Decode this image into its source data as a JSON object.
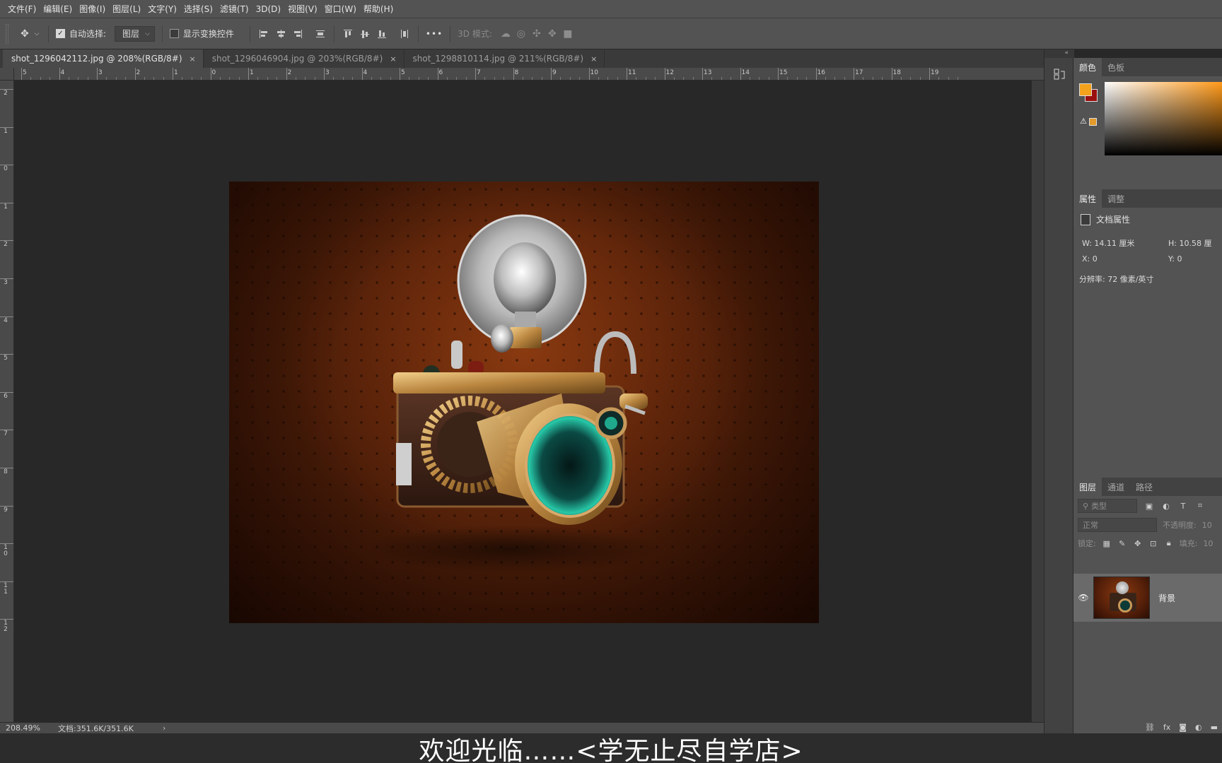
{
  "menu": [
    "文件(F)",
    "编辑(E)",
    "图像(I)",
    "图层(L)",
    "文字(Y)",
    "选择(S)",
    "滤镜(T)",
    "3D(D)",
    "视图(V)",
    "窗口(W)",
    "帮助(H)"
  ],
  "options": {
    "auto_select_label": "自动选择:",
    "auto_select_value": "图层",
    "transform_label": "显示变换控件",
    "more": "•••",
    "mode3d_label": "3D 模式:"
  },
  "tabs": [
    {
      "label": "shot_1296042112.jpg @ 208%(RGB/8#)",
      "close": "×"
    },
    {
      "label": "shot_1296046904.jpg @ 203%(RGB/8#)",
      "close": "×"
    },
    {
      "label": "shot_1298810114.jpg @ 211%(RGB/8#)",
      "close": "×"
    }
  ],
  "ruler_h": [
    "5",
    "4",
    "3",
    "2",
    "1",
    "0",
    "1",
    "2",
    "3",
    "4",
    "5",
    "6",
    "7",
    "8",
    "9",
    "10",
    "11",
    "12",
    "13",
    "14",
    "15",
    "16",
    "17",
    "18",
    "19"
  ],
  "ruler_v": [
    "2",
    "1",
    "0",
    "1",
    "2",
    "3",
    "4",
    "5",
    "6",
    "7",
    "8",
    "9",
    "10",
    "11",
    "12"
  ],
  "status": {
    "zoom": "208.49%",
    "doc": "文档:351.6K/351.6K",
    "arrow": "›"
  },
  "caption": "欢迎光临……<学无止尽自学店>",
  "color_panel": {
    "tabs": [
      "颜色",
      "色板"
    ],
    "fg": "#f4a11c",
    "bg": "#9b0f0f",
    "warn_swatch": "#e39a2a",
    "hue": "#ff9a1a"
  },
  "properties": {
    "tabs": [
      "属性",
      "调整"
    ],
    "heading": "文档属性",
    "w": "W:  14.11  厘米",
    "h": "H:  10.58  厘",
    "x": "X:  0",
    "y": "Y:  0",
    "resolution": "分辨率: 72 像素/英寸"
  },
  "layers": {
    "tabs": [
      "图层",
      "通道",
      "路径"
    ],
    "search_placeholder": "类型",
    "blend_mode": "正常",
    "opacity_label": "不透明度:",
    "opacity_value": "10",
    "lock_label": "锁定:",
    "fill_label": "填充:",
    "fill_value": "10",
    "layer_name": "背景"
  }
}
